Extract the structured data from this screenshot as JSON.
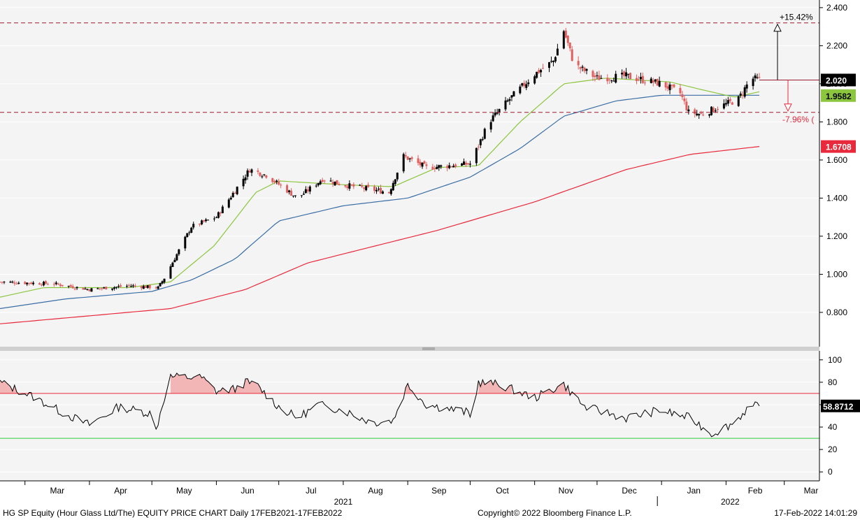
{
  "footer": {
    "left": "HG SP Equity (Hour Glass Ltd/The) EQUITY PRICE CHART  Daily 17FEB2021-17FEB2022",
    "center": "Copyright© 2022 Bloomberg Finance L.P.",
    "right": "17-Feb-2022 14:01:29"
  },
  "colors": {
    "up_candle": "#000000",
    "down_candle": "#e06060",
    "ma_short": "#8cc63f",
    "ma_mid": "#3a6ea5",
    "ma_long": "#e8293b",
    "rsi_line": "#000000",
    "rsi_upper": "#e8293b",
    "rsi_lower": "#2ecc40",
    "reference_lines": "#9b1b30",
    "overbought_fill": "#f3b6b6"
  },
  "chart_data": [
    {
      "type": "candlestick",
      "panel": "price",
      "ylim": [
        0.62,
        2.44
      ],
      "yticks": [
        "2.400",
        "2.200",
        "2.000",
        "1.800",
        "1.600",
        "1.400",
        "1.200",
        "1.000",
        "0.800"
      ],
      "ytick_values": [
        2.4,
        2.2,
        2.0,
        1.8,
        1.6,
        1.4,
        1.2,
        1.0,
        0.8
      ],
      "x_month_ticks": [
        "Mar",
        "Apr",
        "May",
        "Jun",
        "Jul",
        "Aug",
        "Sep",
        "Oct",
        "Nov",
        "Dec",
        "Jan",
        "Feb",
        "Mar"
      ],
      "x_year_labels": [
        "2021",
        "2022"
      ],
      "price_path": [
        [
          "2021-02-17",
          0.96
        ],
        [
          "2021-03-15",
          0.95
        ],
        [
          "2021-04-01",
          0.92
        ],
        [
          "2021-04-20",
          0.94
        ],
        [
          "2021-05-04",
          0.93
        ],
        [
          "2021-05-07",
          0.98
        ],
        [
          "2021-05-20",
          1.25
        ],
        [
          "2021-06-01",
          1.3
        ],
        [
          "2021-06-17",
          1.55
        ],
        [
          "2021-06-25",
          1.52
        ],
        [
          "2021-07-10",
          1.4
        ],
        [
          "2021-07-22",
          1.5
        ],
        [
          "2021-08-01",
          1.47
        ],
        [
          "2021-08-23",
          1.43
        ],
        [
          "2021-08-30",
          1.62
        ],
        [
          "2021-09-10",
          1.56
        ],
        [
          "2021-10-01",
          1.58
        ],
        [
          "2021-10-10",
          1.8
        ],
        [
          "2021-10-20",
          1.92
        ],
        [
          "2021-11-01",
          2.05
        ],
        [
          "2021-11-10",
          2.12
        ],
        [
          "2021-11-15",
          2.28
        ],
        [
          "2021-11-20",
          2.1
        ],
        [
          "2021-12-01",
          2.03
        ],
        [
          "2021-12-15",
          2.04
        ],
        [
          "2022-01-01",
          2.0
        ],
        [
          "2022-01-10",
          1.95
        ],
        [
          "2022-01-14",
          1.85
        ],
        [
          "2022-01-20",
          1.84
        ],
        [
          "2022-02-07",
          1.92
        ],
        [
          "2022-02-13",
          2.03
        ],
        [
          "2022-02-17",
          2.02
        ]
      ],
      "ma_short_path": [
        [
          "2021-02-17",
          0.88
        ],
        [
          "2021-03-10",
          0.93
        ],
        [
          "2021-04-20",
          0.93
        ],
        [
          "2021-05-10",
          0.96
        ],
        [
          "2021-05-31",
          1.15
        ],
        [
          "2021-06-20",
          1.43
        ],
        [
          "2021-07-01",
          1.49
        ],
        [
          "2021-08-01",
          1.47
        ],
        [
          "2021-08-25",
          1.46
        ],
        [
          "2021-09-15",
          1.56
        ],
        [
          "2021-10-05",
          1.57
        ],
        [
          "2021-10-25",
          1.8
        ],
        [
          "2021-11-15",
          2.0
        ],
        [
          "2021-12-05",
          2.03
        ],
        [
          "2022-01-05",
          2.01
        ],
        [
          "2022-01-20",
          1.97
        ],
        [
          "2022-02-05",
          1.93
        ],
        [
          "2022-02-17",
          1.9582
        ]
      ],
      "ma_mid_path": [
        [
          "2021-02-17",
          0.82
        ],
        [
          "2021-03-20",
          0.87
        ],
        [
          "2021-05-01",
          0.91
        ],
        [
          "2021-05-20",
          0.97
        ],
        [
          "2021-06-10",
          1.08
        ],
        [
          "2021-07-01",
          1.28
        ],
        [
          "2021-08-01",
          1.36
        ],
        [
          "2021-09-01",
          1.4
        ],
        [
          "2021-10-01",
          1.51
        ],
        [
          "2021-10-25",
          1.66
        ],
        [
          "2021-11-15",
          1.83
        ],
        [
          "2021-12-10",
          1.91
        ],
        [
          "2022-01-01",
          1.94
        ],
        [
          "2022-02-17",
          1.94
        ]
      ],
      "ma_long_path": [
        [
          "2021-02-17",
          0.74
        ],
        [
          "2021-05-10",
          0.82
        ],
        [
          "2021-06-15",
          0.92
        ],
        [
          "2021-07-15",
          1.06
        ],
        [
          "2021-09-15",
          1.23
        ],
        [
          "2021-11-01",
          1.38
        ],
        [
          "2021-12-15",
          1.55
        ],
        [
          "2022-01-15",
          1.63
        ],
        [
          "2022-02-17",
          1.6708
        ]
      ],
      "last_price": "2.020",
      "ma_short_last": "1.9582",
      "ma_long_last": "1.6708",
      "upper_reference": {
        "value": 2.32,
        "label": "+15.42%"
      },
      "lower_reference": {
        "value": 1.85,
        "label": "-7.96% ("
      }
    },
    {
      "type": "line",
      "panel": "rsi",
      "ylim": [
        -8,
        108
      ],
      "yticks": [
        "100",
        "80",
        "60",
        "40",
        "20",
        "0"
      ],
      "ytick_values": [
        100,
        80,
        60,
        40,
        20,
        0
      ],
      "upper_line": 70,
      "lower_line": 30,
      "last_value": "58.8712",
      "series": [
        [
          "2021-02-17",
          80
        ],
        [
          "2021-03-05",
          67
        ],
        [
          "2021-03-20",
          52
        ],
        [
          "2021-04-01",
          42
        ],
        [
          "2021-04-15",
          58
        ],
        [
          "2021-05-01",
          52
        ],
        [
          "2021-05-03",
          37
        ],
        [
          "2021-05-06",
          60
        ],
        [
          "2021-05-10",
          85
        ],
        [
          "2021-05-25",
          84
        ],
        [
          "2021-06-01",
          72
        ],
        [
          "2021-06-10",
          74
        ],
        [
          "2021-06-15",
          80
        ],
        [
          "2021-06-20",
          78
        ],
        [
          "2021-07-01",
          58
        ],
        [
          "2021-07-10",
          48
        ],
        [
          "2021-07-20",
          60
        ],
        [
          "2021-08-01",
          55
        ],
        [
          "2021-08-15",
          44
        ],
        [
          "2021-08-25",
          46
        ],
        [
          "2021-09-01",
          78
        ],
        [
          "2021-09-10",
          60
        ],
        [
          "2021-09-30",
          53
        ],
        [
          "2021-10-01",
          48
        ],
        [
          "2021-10-05",
          80
        ],
        [
          "2021-10-15",
          78
        ],
        [
          "2021-11-01",
          66
        ],
        [
          "2021-11-10",
          74
        ],
        [
          "2021-11-15",
          78
        ],
        [
          "2021-11-25",
          58
        ],
        [
          "2021-12-15",
          48
        ],
        [
          "2021-12-31",
          55
        ],
        [
          "2022-01-15",
          48
        ],
        [
          "2022-01-25",
          34
        ],
        [
          "2022-02-05",
          44
        ],
        [
          "2022-02-12",
          58
        ],
        [
          "2022-02-17",
          58.8712
        ]
      ]
    }
  ]
}
